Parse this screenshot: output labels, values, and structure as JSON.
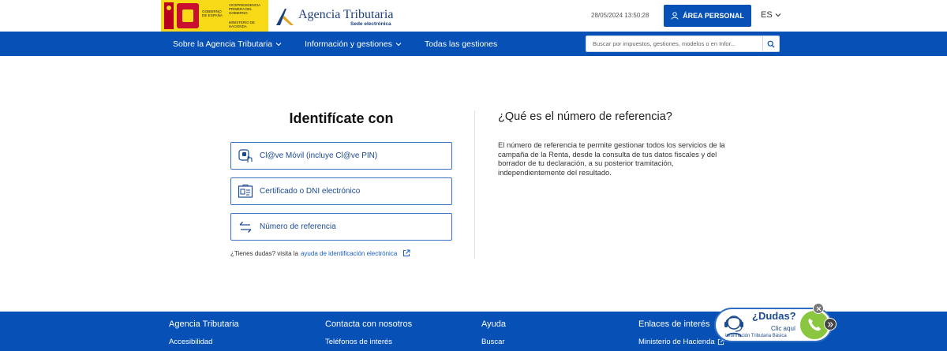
{
  "header": {
    "gov_logo": {
      "line1": "GOBIERNO DE ESPAÑA",
      "line2": "VICEPRESIDENCIA PRIMERA DEL GOBIERNO",
      "line3": "MINISTERIO DE HACIENDA"
    },
    "agency_name": "Agencia Tributaria",
    "agency_sub": "Sede electrónica",
    "datetime": "28/05/2024 13:50:28",
    "area_personal": "ÁREA PERSONAL",
    "language": "ES"
  },
  "nav": {
    "items": [
      {
        "label": "Sobre la Agencia Tributaria"
      },
      {
        "label": "Información y gestiones"
      },
      {
        "label": "Todas las gestiones"
      }
    ],
    "search_placeholder": "Buscar por impuestos, gestiones, modelos o en Infor..."
  },
  "login": {
    "title": "Identifícate con",
    "options": [
      {
        "label": "Cl@ve Móvil (incluye Cl@ve PIN)",
        "icon": "mobile-touch-icon"
      },
      {
        "label": "Certificado o DNI electrónico",
        "icon": "id-card-icon"
      },
      {
        "label": "Número de referencia",
        "icon": "swap-arrows-icon"
      }
    ],
    "help_prefix": "¿Tienes dudas? visita la",
    "help_link": "ayuda de identificación electrónica"
  },
  "info": {
    "title": "¿Qué es el número de referencia?",
    "text": "El número de referencia te permite gestionar todos los servicios de la campaña de la Renta, desde la consulta de tus datos fiscales y del borrador de tu declaración, a su posterior tramitación, independientemente del resultado."
  },
  "footer": {
    "columns": [
      {
        "heading": "Agencia Tributaria",
        "link": "Accesibilidad"
      },
      {
        "heading": "Contacta con nosotros",
        "link": "Teléfonos de interés"
      },
      {
        "heading": "Ayuda",
        "link": "Buscar"
      },
      {
        "heading": "Enlaces de interés",
        "link": "Ministerio de Hacienda"
      }
    ]
  },
  "dudas": {
    "title": "¿Dudas?",
    "click": "Clic aquí",
    "sub": "Información Tributaria Básica"
  },
  "colors": {
    "brand_blue": "#0650b6",
    "border_blue": "#3a73c4",
    "gov_yellow": "#f7d917",
    "gov_red": "#c8102e",
    "phone_green": "#8bc640"
  }
}
